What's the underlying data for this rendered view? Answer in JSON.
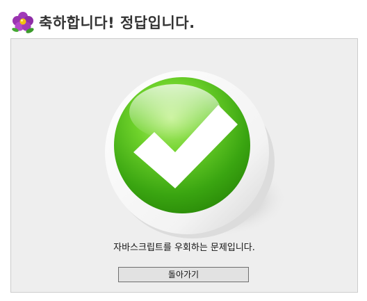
{
  "header": {
    "icon": "flower-icon",
    "title": "축하합니다! 정답입니다."
  },
  "result": {
    "icon": "green-checkmark-icon",
    "message": "자바스크립트를 우회하는 문제입니다.",
    "back_button_label": "돌아가기"
  },
  "colors": {
    "panel_background": "#eeeeee",
    "panel_border": "#cccccc",
    "check_green": "#3aa511",
    "title_text": "#333333"
  }
}
